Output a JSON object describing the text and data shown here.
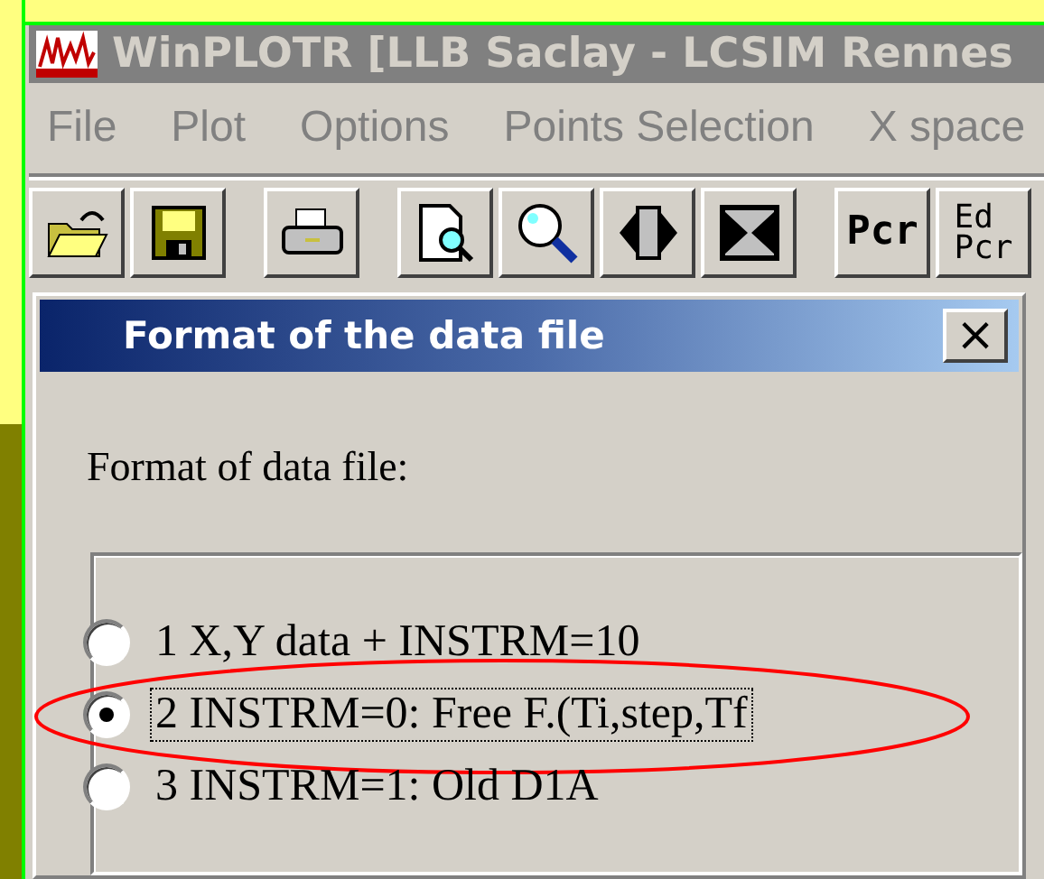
{
  "window": {
    "title": "WinPLOTR [LLB Saclay - LCSIM Rennes"
  },
  "menu": [
    "File",
    "Plot",
    "Options",
    "Points Selection",
    "X space"
  ],
  "toolbar": [
    [
      {
        "kind": "open"
      },
      {
        "kind": "save"
      }
    ],
    [
      {
        "kind": "print"
      }
    ],
    [
      {
        "kind": "preview"
      },
      {
        "kind": "zoom"
      },
      {
        "kind": "expand"
      },
      {
        "kind": "shrink"
      }
    ],
    [
      {
        "kind": "text",
        "label": "Pcr"
      },
      {
        "kind": "text",
        "label": "Ed\nPcr"
      }
    ]
  ],
  "dialog": {
    "title": "Format of the data file",
    "close": "×",
    "prompt": "Format of data file:",
    "options": [
      {
        "label": "1 X,Y data + INSTRM=10",
        "selected": false,
        "highlighted": false
      },
      {
        "label": "2 INSTRM=0: Free F.(Ti,step,Tf",
        "selected": true,
        "highlighted": true
      },
      {
        "label": "3 INSTRM=1: Old D1A",
        "selected": false,
        "highlighted": false
      }
    ]
  }
}
